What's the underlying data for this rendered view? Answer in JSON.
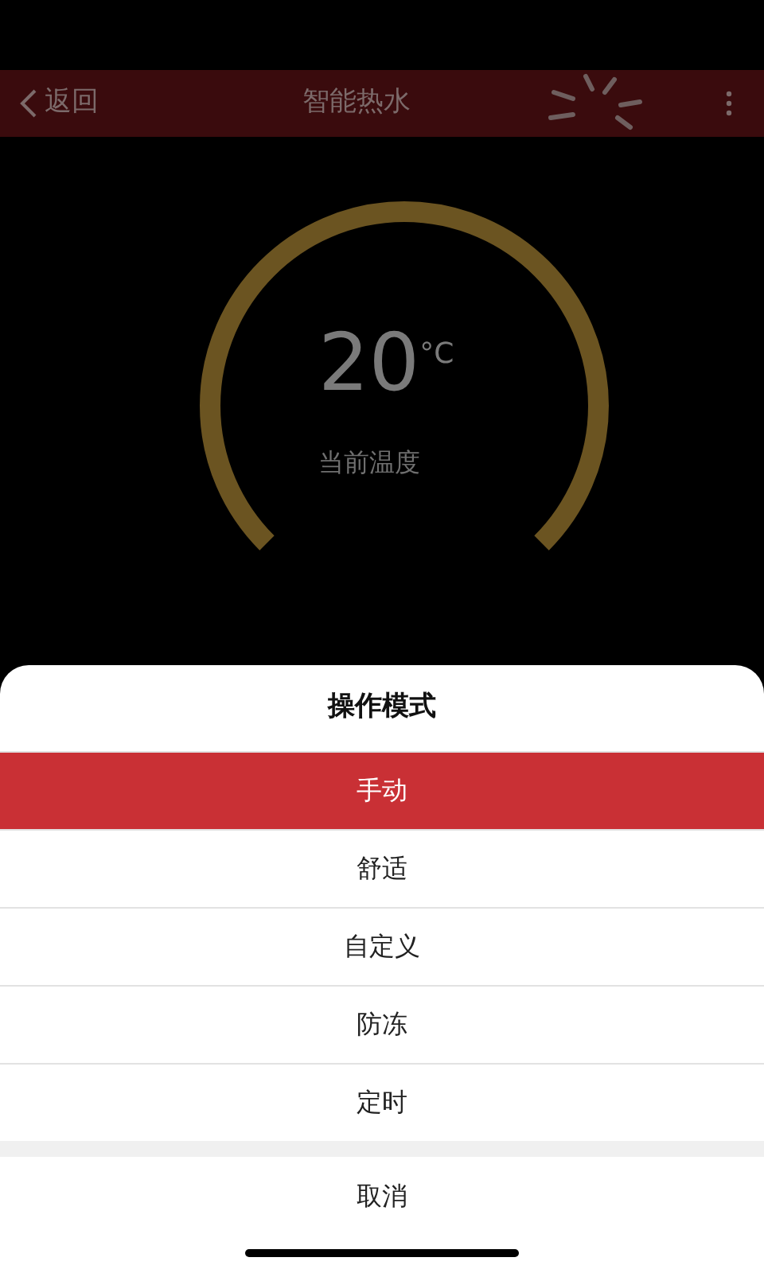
{
  "header": {
    "back_label": "返回",
    "title": "智能热水"
  },
  "gauge": {
    "temperature": "20",
    "unit": "°C",
    "caption": "当前温度"
  },
  "sheet": {
    "title": "操作模式",
    "options": [
      {
        "label": "手动",
        "selected": true
      },
      {
        "label": "舒适",
        "selected": false
      },
      {
        "label": "自定义",
        "selected": false
      },
      {
        "label": "防冻",
        "selected": false
      },
      {
        "label": "定时",
        "selected": false
      }
    ],
    "cancel": "取消"
  }
}
